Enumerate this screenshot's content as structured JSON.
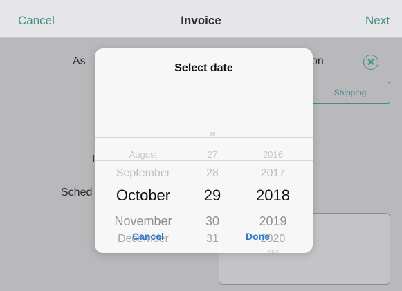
{
  "navbar": {
    "cancel": "Cancel",
    "title": "Invoice",
    "next": "Next"
  },
  "form": {
    "assign_label_fragment": "As",
    "option_label_fragment": "on",
    "shipping_button": "Shipping",
    "i_fragment": "I",
    "schedule_label_fragment": "Sched"
  },
  "picker": {
    "title": "Select date",
    "rows": [
      {
        "month": "",
        "day": "26",
        "year": ""
      },
      {
        "month": "August",
        "day": "27",
        "year": "2016"
      },
      {
        "month": "September",
        "day": "28",
        "year": "2017"
      },
      {
        "month": "October",
        "day": "29",
        "year": "2018"
      },
      {
        "month": "November",
        "day": "30",
        "year": "2019"
      },
      {
        "month": "December",
        "day": "31",
        "year": "2020"
      },
      {
        "month": "",
        "day": "",
        "year": "2021"
      }
    ],
    "selected_index": 3,
    "cancel": "Cancel",
    "done": "Done"
  },
  "colors": {
    "accent": "#3c8f8a",
    "dialog_button": "#2f78c7"
  }
}
